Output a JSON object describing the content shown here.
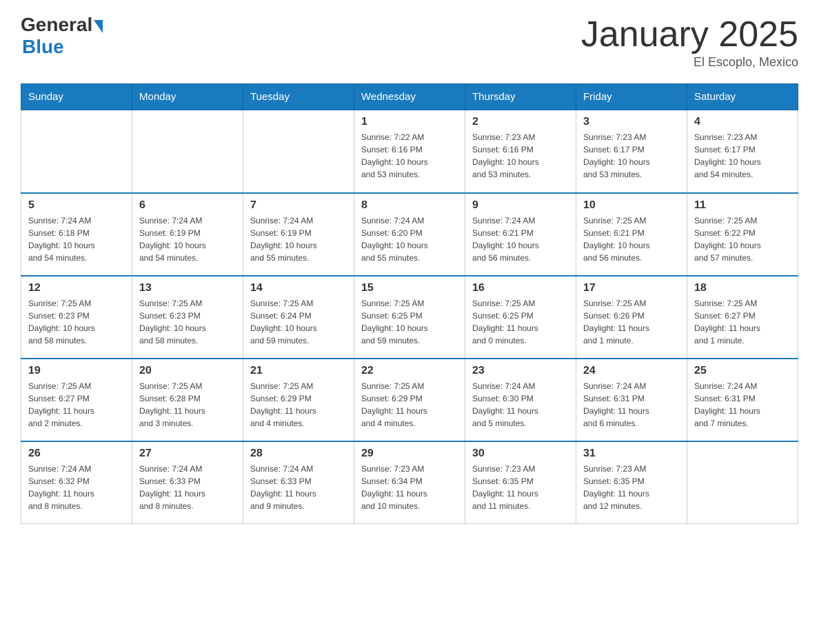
{
  "logo": {
    "text_general": "General",
    "text_blue": "Blue",
    "arrow": "▶"
  },
  "header": {
    "title": "January 2025",
    "location": "El Escoplo, Mexico"
  },
  "weekdays": [
    "Sunday",
    "Monday",
    "Tuesday",
    "Wednesday",
    "Thursday",
    "Friday",
    "Saturday"
  ],
  "weeks": [
    [
      {
        "day": "",
        "info": ""
      },
      {
        "day": "",
        "info": ""
      },
      {
        "day": "",
        "info": ""
      },
      {
        "day": "1",
        "info": "Sunrise: 7:22 AM\nSunset: 6:16 PM\nDaylight: 10 hours\nand 53 minutes."
      },
      {
        "day": "2",
        "info": "Sunrise: 7:23 AM\nSunset: 6:16 PM\nDaylight: 10 hours\nand 53 minutes."
      },
      {
        "day": "3",
        "info": "Sunrise: 7:23 AM\nSunset: 6:17 PM\nDaylight: 10 hours\nand 53 minutes."
      },
      {
        "day": "4",
        "info": "Sunrise: 7:23 AM\nSunset: 6:17 PM\nDaylight: 10 hours\nand 54 minutes."
      }
    ],
    [
      {
        "day": "5",
        "info": "Sunrise: 7:24 AM\nSunset: 6:18 PM\nDaylight: 10 hours\nand 54 minutes."
      },
      {
        "day": "6",
        "info": "Sunrise: 7:24 AM\nSunset: 6:19 PM\nDaylight: 10 hours\nand 54 minutes."
      },
      {
        "day": "7",
        "info": "Sunrise: 7:24 AM\nSunset: 6:19 PM\nDaylight: 10 hours\nand 55 minutes."
      },
      {
        "day": "8",
        "info": "Sunrise: 7:24 AM\nSunset: 6:20 PM\nDaylight: 10 hours\nand 55 minutes."
      },
      {
        "day": "9",
        "info": "Sunrise: 7:24 AM\nSunset: 6:21 PM\nDaylight: 10 hours\nand 56 minutes."
      },
      {
        "day": "10",
        "info": "Sunrise: 7:25 AM\nSunset: 6:21 PM\nDaylight: 10 hours\nand 56 minutes."
      },
      {
        "day": "11",
        "info": "Sunrise: 7:25 AM\nSunset: 6:22 PM\nDaylight: 10 hours\nand 57 minutes."
      }
    ],
    [
      {
        "day": "12",
        "info": "Sunrise: 7:25 AM\nSunset: 6:23 PM\nDaylight: 10 hours\nand 58 minutes."
      },
      {
        "day": "13",
        "info": "Sunrise: 7:25 AM\nSunset: 6:23 PM\nDaylight: 10 hours\nand 58 minutes."
      },
      {
        "day": "14",
        "info": "Sunrise: 7:25 AM\nSunset: 6:24 PM\nDaylight: 10 hours\nand 59 minutes."
      },
      {
        "day": "15",
        "info": "Sunrise: 7:25 AM\nSunset: 6:25 PM\nDaylight: 10 hours\nand 59 minutes."
      },
      {
        "day": "16",
        "info": "Sunrise: 7:25 AM\nSunset: 6:25 PM\nDaylight: 11 hours\nand 0 minutes."
      },
      {
        "day": "17",
        "info": "Sunrise: 7:25 AM\nSunset: 6:26 PM\nDaylight: 11 hours\nand 1 minute."
      },
      {
        "day": "18",
        "info": "Sunrise: 7:25 AM\nSunset: 6:27 PM\nDaylight: 11 hours\nand 1 minute."
      }
    ],
    [
      {
        "day": "19",
        "info": "Sunrise: 7:25 AM\nSunset: 6:27 PM\nDaylight: 11 hours\nand 2 minutes."
      },
      {
        "day": "20",
        "info": "Sunrise: 7:25 AM\nSunset: 6:28 PM\nDaylight: 11 hours\nand 3 minutes."
      },
      {
        "day": "21",
        "info": "Sunrise: 7:25 AM\nSunset: 6:29 PM\nDaylight: 11 hours\nand 4 minutes."
      },
      {
        "day": "22",
        "info": "Sunrise: 7:25 AM\nSunset: 6:29 PM\nDaylight: 11 hours\nand 4 minutes."
      },
      {
        "day": "23",
        "info": "Sunrise: 7:24 AM\nSunset: 6:30 PM\nDaylight: 11 hours\nand 5 minutes."
      },
      {
        "day": "24",
        "info": "Sunrise: 7:24 AM\nSunset: 6:31 PM\nDaylight: 11 hours\nand 6 minutes."
      },
      {
        "day": "25",
        "info": "Sunrise: 7:24 AM\nSunset: 6:31 PM\nDaylight: 11 hours\nand 7 minutes."
      }
    ],
    [
      {
        "day": "26",
        "info": "Sunrise: 7:24 AM\nSunset: 6:32 PM\nDaylight: 11 hours\nand 8 minutes."
      },
      {
        "day": "27",
        "info": "Sunrise: 7:24 AM\nSunset: 6:33 PM\nDaylight: 11 hours\nand 8 minutes."
      },
      {
        "day": "28",
        "info": "Sunrise: 7:24 AM\nSunset: 6:33 PM\nDaylight: 11 hours\nand 9 minutes."
      },
      {
        "day": "29",
        "info": "Sunrise: 7:23 AM\nSunset: 6:34 PM\nDaylight: 11 hours\nand 10 minutes."
      },
      {
        "day": "30",
        "info": "Sunrise: 7:23 AM\nSunset: 6:35 PM\nDaylight: 11 hours\nand 11 minutes."
      },
      {
        "day": "31",
        "info": "Sunrise: 7:23 AM\nSunset: 6:35 PM\nDaylight: 11 hours\nand 12 minutes."
      },
      {
        "day": "",
        "info": ""
      }
    ]
  ]
}
